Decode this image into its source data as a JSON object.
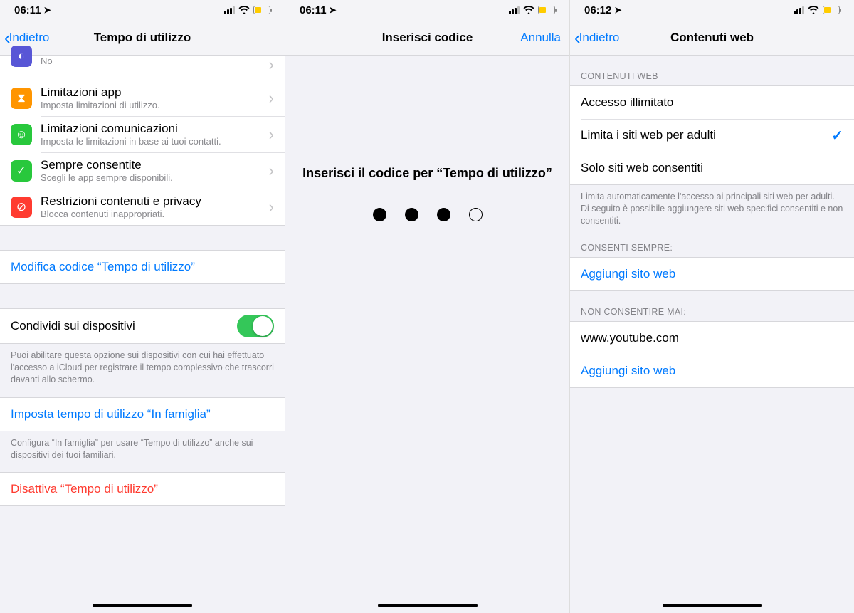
{
  "screen1": {
    "status_time": "06:11",
    "nav_back": "Indietro",
    "nav_title": "Tempo di utilizzo",
    "row_partial_sub": "No",
    "rows": [
      {
        "title": "Limitazioni app",
        "sub": "Imposta limitazioni di utilizzo."
      },
      {
        "title": "Limitazioni comunicazioni",
        "sub": "Imposta le limitazioni in base ai tuoi contatti."
      },
      {
        "title": "Sempre consentite",
        "sub": "Scegli le app sempre disponibili."
      },
      {
        "title": "Restrizioni contenuti e privacy",
        "sub": "Blocca contenuti inappropriati."
      }
    ],
    "link_editcode": "Modifica codice “Tempo di utilizzo”",
    "toggle_label": "Condividi sui dispositivi",
    "toggle_footer": "Puoi abilitare questa opzione sui dispositivi con cui hai effettuato l'accesso a iCloud per registrare il tempo complessivo che trascorri davanti allo schermo.",
    "link_family": "Imposta tempo di utilizzo “In famiglia”",
    "family_footer": "Configura “In famiglia” per usare “Tempo di utilizzo” anche sui dispositivi dei tuoi familiari.",
    "link_disable": "Disattiva “Tempo di utilizzo”"
  },
  "screen2": {
    "status_time": "06:11",
    "nav_title": "Inserisci codice",
    "nav_cancel": "Annulla",
    "prompt": "Inserisci il codice per “Tempo di utilizzo”",
    "dots_filled": 3,
    "dots_total": 4
  },
  "screen3": {
    "status_time": "06:12",
    "nav_back": "Indietro",
    "nav_title": "Contenuti web",
    "section1_header": "CONTENUTI WEB",
    "options": [
      {
        "label": "Accesso illimitato",
        "checked": false
      },
      {
        "label": "Limita i siti web per adulti",
        "checked": true
      },
      {
        "label": "Solo siti web consentiti",
        "checked": false
      }
    ],
    "section1_footer": "Limita automaticamente l'accesso ai principali siti web per adulti. Di seguito è possibile aggiungere siti web specifici consentiti e non consentiti.",
    "section2_header": "CONSENTI SEMPRE:",
    "add_site_label": "Aggiungi sito web",
    "section3_header": "NON CONSENTIRE MAI:",
    "blocked_site": "www.youtube.com"
  }
}
